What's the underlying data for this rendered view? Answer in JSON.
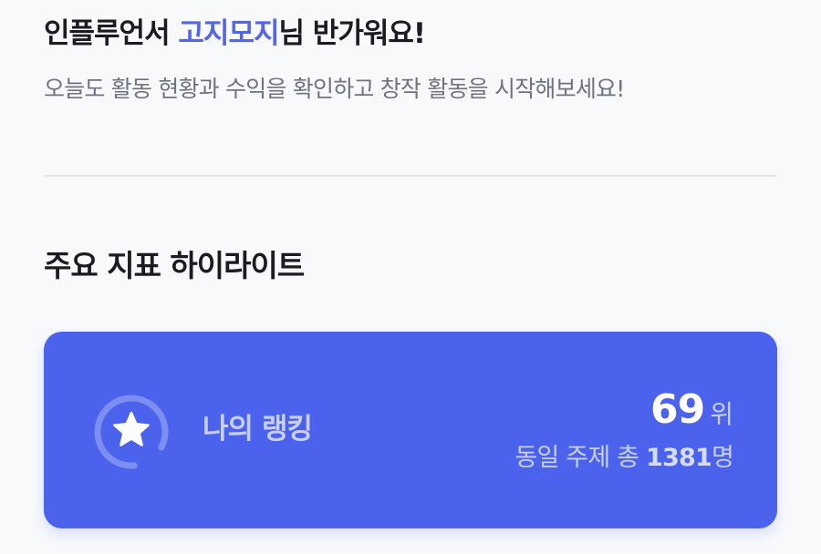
{
  "greeting": {
    "prefix": "인플루언서 ",
    "nickname": "고지모지",
    "suffix": "님 반가워요!"
  },
  "subtitle": "오늘도 활동 현황과 수익을 확인하고 창작 활동을 시작해보세요!",
  "highlight": {
    "title": "주요 지표 하이라이트",
    "ranking": {
      "label": "나의 랭킹",
      "rank": "69",
      "rank_unit": "위",
      "total_prefix": "동일 주제 총 ",
      "total_count": "1381",
      "total_suffix": "명",
      "icon": "star-icon"
    }
  },
  "colors": {
    "accent": "#5465e8",
    "card_bg": "#4b63ec",
    "card_text_muted": "#c7cffa",
    "page_bg": "#f8f9fb"
  }
}
